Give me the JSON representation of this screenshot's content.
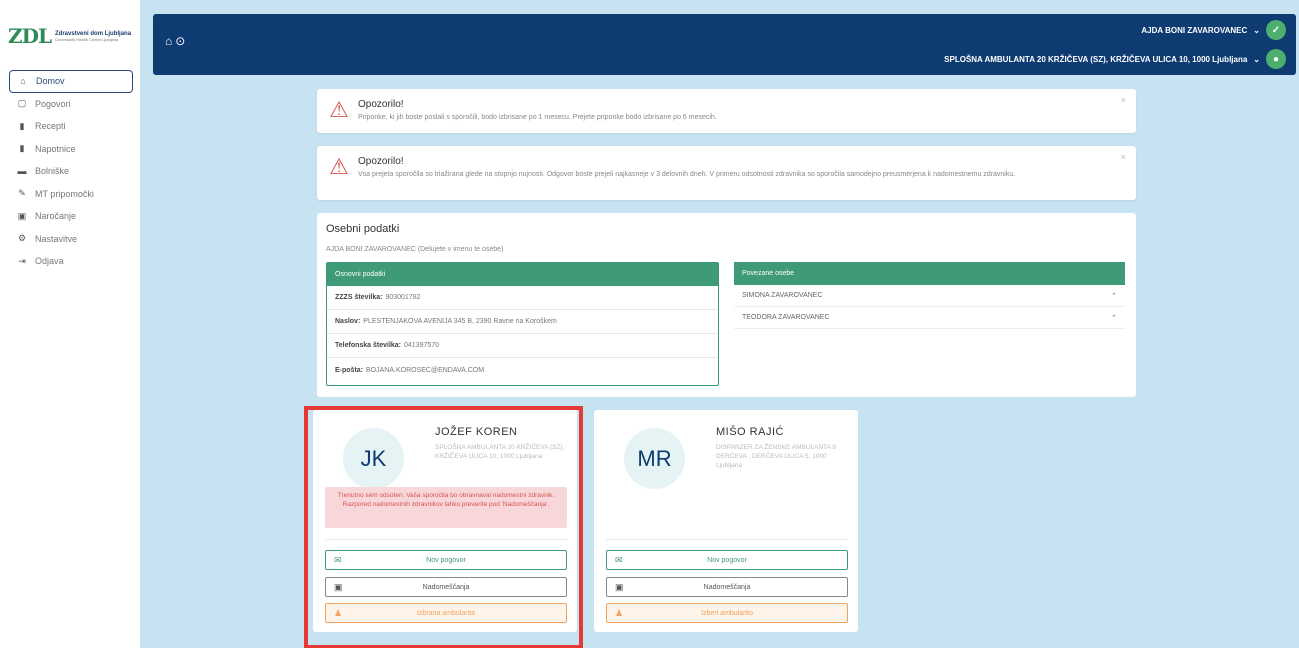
{
  "app": {
    "logo_mark": "ZDL",
    "logo_title": "Zdravstveni dom Ljubljana",
    "logo_subtitle": "Community Health Centre Ljubljana"
  },
  "sidebar": {
    "items": [
      {
        "label": "Domov",
        "icon": "home-icon",
        "glyph": "⌂",
        "active": true
      },
      {
        "label": "Pogovori",
        "icon": "chat-icon",
        "glyph": "▢"
      },
      {
        "label": "Recepti",
        "icon": "prescription-icon",
        "glyph": "▮"
      },
      {
        "label": "Napotnice",
        "icon": "referral-icon",
        "glyph": "▮"
      },
      {
        "label": "Bolniške",
        "icon": "bed-icon",
        "glyph": "▬"
      },
      {
        "label": "MT pripomočki",
        "icon": "pen-icon",
        "glyph": "✎"
      },
      {
        "label": "Naročanje",
        "icon": "calendar-icon",
        "glyph": "▣"
      },
      {
        "label": "Nastavitve",
        "icon": "gear-icon",
        "glyph": "⚙"
      },
      {
        "label": "Odjava",
        "icon": "logout-icon",
        "glyph": "⇥"
      }
    ]
  },
  "topbar": {
    "user_name": "AJDA BONI ZAVAROVANEC",
    "ambulanta": "SPLOŠNA AMBULANTA 20 KRŽIČEVA (SZ), KRŽIČEVA ULICA 10, 1000 Ljubljana"
  },
  "alerts": [
    {
      "title": "Opozorilo!",
      "body": "Priponke, ki jih boste poslali s sporočili, bodo izbrisane po 1 mesecu. Prejete priponke bodo izbrisane po 6 mesecih."
    },
    {
      "title": "Opozorilo!",
      "body": "Vsa prejeta sporočila so triažirana glede na stopnjo nujnosti. Odgovor boste prejeli najkasneje v 3 delovnih dneh. V primeru odsotnosti zdravnika so sporočila samodejno preusmerjena k nadomestnemu zdravniku."
    }
  ],
  "personal": {
    "title": "Osebni podatki",
    "subtitle": "AJDA BONI ZAVAROVANEC (Delujete v imenu te osebe)",
    "basic_header": "Osnovni podatki",
    "rows": [
      {
        "label": "ZZZS številka:",
        "value": "903001782"
      },
      {
        "label": "Naslov:",
        "value": "PLESTENJAKOVA AVENIJA 345 B, 2390 Ravne na Koroškem"
      },
      {
        "label": "Telefonska številka:",
        "value": "041397570"
      },
      {
        "label": "E-pošta:",
        "value": "BOJANA.KOROSEC@ENDAVA.COM"
      }
    ],
    "related_header": "Povezane osebe",
    "related": [
      "SIMONA ZAVAROVANEC",
      "TEODORA ZAVAROVANEC"
    ]
  },
  "doctors": [
    {
      "initials": "JK",
      "name": "JOŽEF KOREN",
      "ambulanta": "SPLOŠNA AMBULANTA 20 KRŽIČEVA (SZ), KRŽIČEVA ULICA 10, 1000 Ljubljana",
      "absence": "Trenutno sem odsoten. Vaša sporočila bo obravnaval nadomestni zdravnik. Razpored nadomestnih zdravnikov lahko preverite pod 'Nadomeščanja'.",
      "btn_new": "Nov pogovor",
      "btn_subst": "Nadomeščanja",
      "btn_select": "Izbrana ambulanta"
    },
    {
      "initials": "MR",
      "name": "MIŠO RAJIĆ",
      "ambulanta": "DISPANZER ZA ŽENSKE AMBULANTA 8 DERČEVA , DERČEVA ULICA 5, 1000 Ljubljana",
      "btn_new": "Nov pogovor",
      "btn_subst": "Nadomeščanja",
      "btn_select": "Izberi ambulanto"
    }
  ],
  "colors": {
    "primary": "#0d3b72",
    "accent_green": "#3f9a78",
    "background": "#c7e3f1",
    "warning": "#d9534f",
    "orange": "#f0a35e",
    "highlight": "#e53935"
  }
}
